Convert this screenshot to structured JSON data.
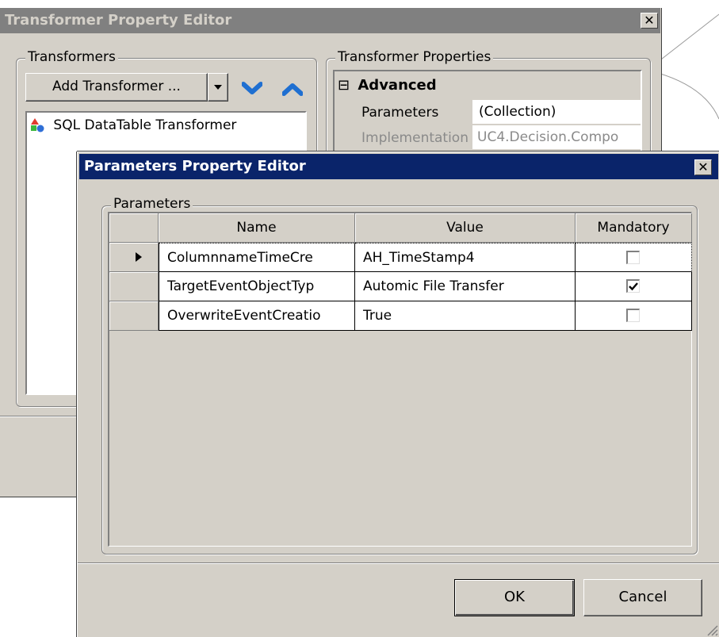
{
  "back_window": {
    "title": "Transformer Property Editor",
    "transformers_group": "Transformers",
    "add_button": "Add Transformer ...",
    "list_items": [
      "SQL DataTable Transformer"
    ],
    "properties_group": "Transformer Properties",
    "category": "Advanced",
    "category_toggle": "⊟",
    "properties": [
      {
        "name": "Parameters",
        "value": "(Collection)"
      },
      {
        "name": "Implementation",
        "value": "UC4.Decision.Compo"
      }
    ]
  },
  "dialog": {
    "title": "Parameters Property Editor",
    "group": "Parameters",
    "columns": [
      "Name",
      "Value",
      "Mandatory"
    ],
    "rows": [
      {
        "name": "ColumnnameTimeCre",
        "value": "AH_TimeStamp4",
        "mandatory": false,
        "current": true
      },
      {
        "name": "TargetEventObjectTyp",
        "value": "Automic File Transfer",
        "mandatory": true,
        "current": false
      },
      {
        "name": "OverwriteEventCreatio",
        "value": "True",
        "mandatory": false,
        "current": false
      }
    ],
    "ok_label": "OK",
    "cancel_label": "Cancel"
  },
  "colors": {
    "back_titlebar": "#808080",
    "dialog_titlebar": "#0a246a",
    "face": "#d4d0c8"
  }
}
